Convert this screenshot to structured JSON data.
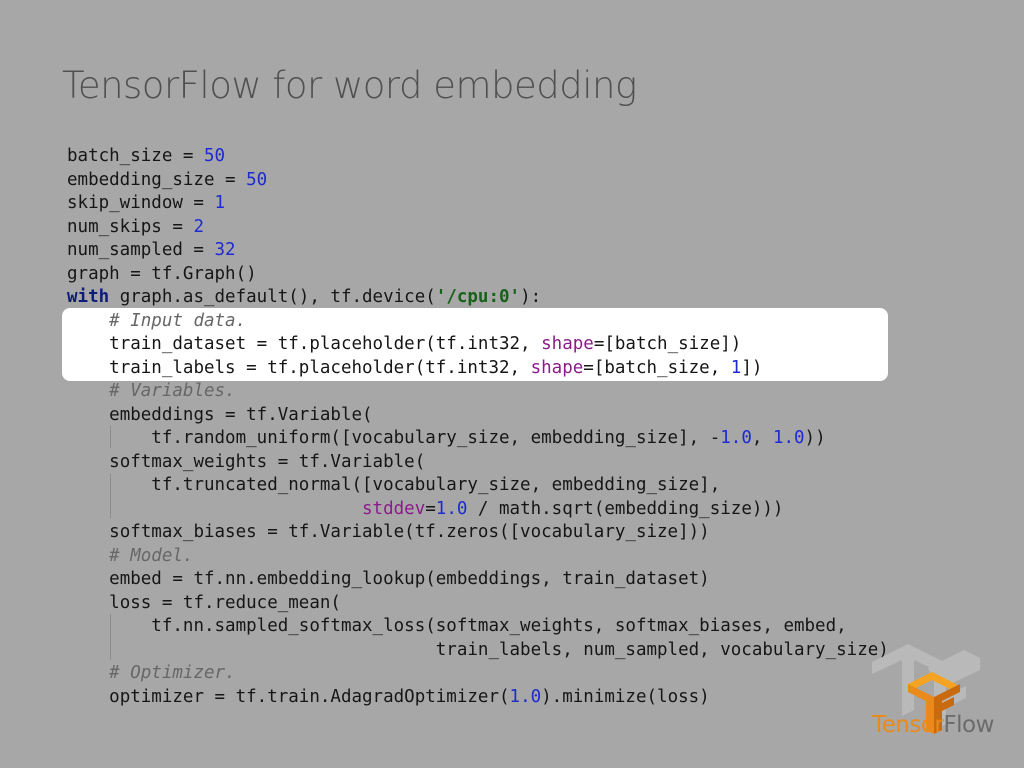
{
  "slide": {
    "title": "TensorFlow for word embedding"
  },
  "code": {
    "l1": {
      "a": "batch_size = ",
      "n": "50"
    },
    "l2": {
      "a": "embedding_size = ",
      "n": "50"
    },
    "l3": {
      "a": "skip_window = ",
      "n": "1"
    },
    "l4": {
      "a": "num_skips = ",
      "n": "2"
    },
    "l5": {
      "a": "num_sampled = ",
      "n": "32"
    },
    "l6": {
      "a": "graph = tf.Graph()"
    },
    "l7": {
      "kw": "with",
      "a": " graph.as_default(), tf.device(",
      "s": "'/cpu:0'",
      "b": "):"
    },
    "l8": {
      "c": "# Input data."
    },
    "l9": {
      "a": "train_dataset = tf.placeholder(tf.int32, ",
      "k": "shape",
      "b": "=[batch_size])"
    },
    "l10": {
      "a": "train_labels = tf.placeholder(tf.int32, ",
      "k": "shape",
      "b": "=[batch_size, ",
      "n": "1",
      "c2": "])"
    },
    "l11": {
      "c": "# Variables."
    },
    "l12": {
      "a": "embeddings = tf.Variable("
    },
    "l13": {
      "a": "tf.random_uniform([vocabulary_size, embedding_size], -",
      "n": "1.0",
      "b": ", ",
      "n2": "1.0",
      "c2": "))"
    },
    "l14": {
      "a": "softmax_weights = tf.Variable("
    },
    "l15": {
      "a": "tf.truncated_normal([vocabulary_size, embedding_size],"
    },
    "l16": {
      "k": "stddev",
      "b": "=",
      "n": "1.0",
      "c2": " / math.sqrt(embedding_size)))"
    },
    "l17": {
      "a": "softmax_biases = tf.Variable(tf.zeros([vocabulary_size]))"
    },
    "l18": {
      "c": "# Model."
    },
    "l19": {
      "a": "embed = tf.nn.embedding_lookup(embeddings, train_dataset)"
    },
    "l20": {
      "a": "loss = tf.reduce_mean("
    },
    "l21": {
      "a": "tf.nn.sampled_softmax_loss(softmax_weights, softmax_biases, embed,"
    },
    "l22": {
      "a": "train_labels, num_sampled, vocabulary_size)"
    },
    "l23": {
      "c": "# Optimizer."
    },
    "l24": {
      "a": "optimizer = tf.train.AdagradOptimizer(",
      "n": "1.0",
      "b": ").minimize(loss)"
    }
  },
  "logo": {
    "icon": "tensorflow-logo",
    "word_part1": "Tensor",
    "word_part2": "Flow",
    "colors": {
      "orange": "#e98a1a",
      "gray": "#6b6b6b"
    }
  },
  "colors": {
    "background": "#a7a7a7",
    "highlight": "#ffffff",
    "number": "#1d2bd1",
    "string": "#17621a",
    "keyword_argument": "#8d1a8a",
    "comment": "#676767"
  }
}
